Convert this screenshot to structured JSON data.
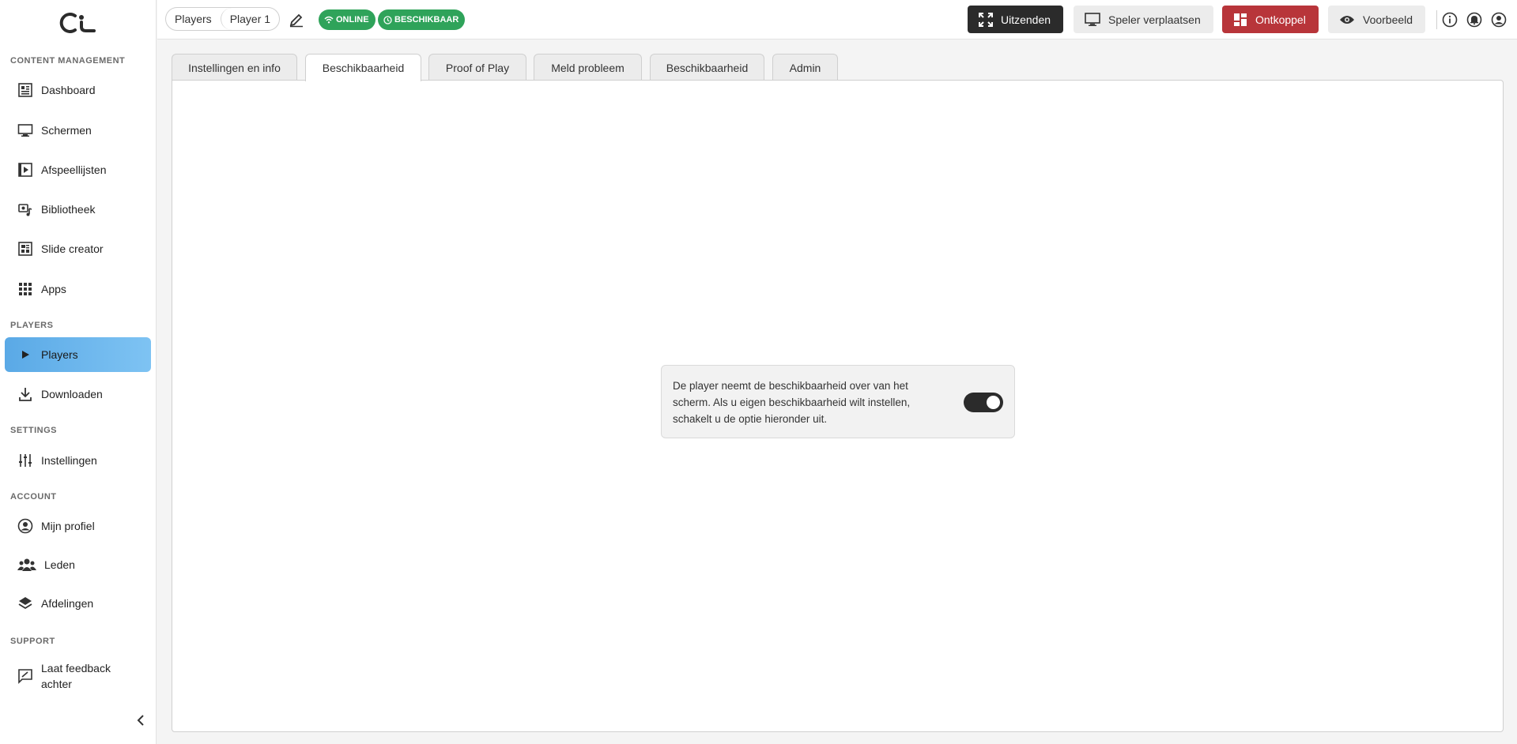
{
  "sidebar": {
    "sections": {
      "content": "CONTENT MANAGEMENT",
      "players": "PLAYERS",
      "settings": "SETTINGS",
      "account": "ACCOUNT",
      "support": "SUPPORT"
    },
    "items": {
      "dashboard": "Dashboard",
      "schermen": "Schermen",
      "afspeellijsten": "Afspeellijsten",
      "bibliotheek": "Bibliotheek",
      "slide_creator": "Slide creator",
      "apps": "Apps",
      "players": "Players",
      "downloaden": "Downloaden",
      "instellingen": "Instellingen",
      "mijn_profiel": "Mijn profiel",
      "leden": "Leden",
      "afdelingen": "Afdelingen",
      "feedback_line1": "Laat feedback",
      "feedback_line2": "achter"
    },
    "active_item": "Players"
  },
  "topbar": {
    "breadcrumb": [
      "Players",
      "Player 1"
    ],
    "badges": {
      "online": "ONLINE",
      "beschikbaar": "BESCHIKBAAR"
    },
    "buttons": {
      "uitzenden": "Uitzenden",
      "speler_verplaatsen": "Speler verplaatsen",
      "ontkoppel": "Ontkoppel",
      "voorbeeld": "Voorbeeld"
    },
    "icons": [
      "info-icon",
      "bell-icon",
      "account-icon"
    ]
  },
  "tabs": [
    "Instellingen en info",
    "Beschikbaarheid",
    "Proof of Play",
    "Meld probleem",
    "Beschikbaarheid",
    "Admin"
  ],
  "active_tab": "Beschikbaarheid",
  "notice": {
    "line1": "De player neemt de beschikbaarheid over van het",
    "line2": "scherm. Als u eigen beschikbaarheid wilt instellen,",
    "line3": "schakelt u de optie hieronder uit.",
    "toggle_on": true
  },
  "colors": {
    "accent": "#5aa9e6",
    "online_green": "#2fa35a",
    "danger_red": "#b8353a",
    "dark": "#2b2b2b"
  }
}
